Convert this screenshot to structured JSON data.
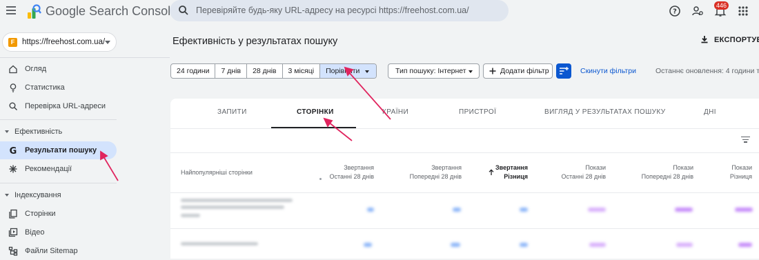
{
  "app": {
    "title": "Google Search Console"
  },
  "search": {
    "placeholder": "Перевіряйте будь-яку URL-адресу на ресурсі https://freehost.com.ua/"
  },
  "topbar": {
    "notifications_count": "446",
    "icons": [
      "help-icon",
      "account-settings-icon",
      "notifications-icon",
      "apps-grid-icon"
    ]
  },
  "property": {
    "label": "https://freehost.com.ua/"
  },
  "sidebar": {
    "items": [
      {
        "label": "Огляд",
        "icon": "home-icon"
      },
      {
        "label": "Статистика",
        "icon": "lightbulb-icon"
      },
      {
        "label": "Перевірка URL-адреси",
        "icon": "search-icon"
      }
    ],
    "section_performance": "Ефективність",
    "performance_items": [
      {
        "label": "Результати пошуку",
        "icon": "google-g-icon",
        "active": true
      },
      {
        "label": "Рекомендації",
        "icon": "sparkle-icon"
      }
    ],
    "section_indexing": "Індексування",
    "indexing_items": [
      {
        "label": "Сторінки",
        "icon": "pages-icon"
      },
      {
        "label": "Відео",
        "icon": "video-icon"
      },
      {
        "label": "Файли Sitemap",
        "icon": "sitemap-icon"
      }
    ]
  },
  "main": {
    "title": "Ефективність у результатах пошуку",
    "export_label": "ЕКСПОРТУВАТ",
    "date_ranges": [
      "24 години",
      "7 днів",
      "28 днів",
      "3 місяці",
      "Порівняти"
    ],
    "search_type_label": "Тип пошуку: Інтернет",
    "add_filter_label": "Додати фільтр",
    "reset_filters_label": "Скинути фільтри",
    "last_updated": "Останнє оновлення: 4 години то"
  },
  "tabs": [
    "ЗАПИТИ",
    "СТОРІНКИ",
    "КРАЇНИ",
    "ПРИСТРОЇ",
    "ВИГЛЯД У РЕЗУЛЬТАТАХ ПОШУКУ",
    "ДНІ"
  ],
  "active_tab": "СТОРІНКИ",
  "table": {
    "first_column": "Найпопулярніші сторінки",
    "columns": [
      {
        "line1": "Звертання",
        "line2": "Останні 28 днів"
      },
      {
        "line1": "Звертання",
        "line2": "Попередні 28 днів"
      },
      {
        "line1": "Звертання",
        "line2": "Різниця",
        "sorted": true
      },
      {
        "line1": "Покази",
        "line2": "Останні 28 днів"
      },
      {
        "line1": "Покази",
        "line2": "Попередні 28 днів"
      },
      {
        "line1": "Покази",
        "line2": "Різниця"
      }
    ]
  },
  "colors": {
    "accent": "#0b57d0",
    "selected_bg": "#d3e3fd",
    "annotation_arrow": "#e0245e",
    "clicks_blur": "#8ab4f8",
    "impressions_blur": "#c58af9"
  }
}
